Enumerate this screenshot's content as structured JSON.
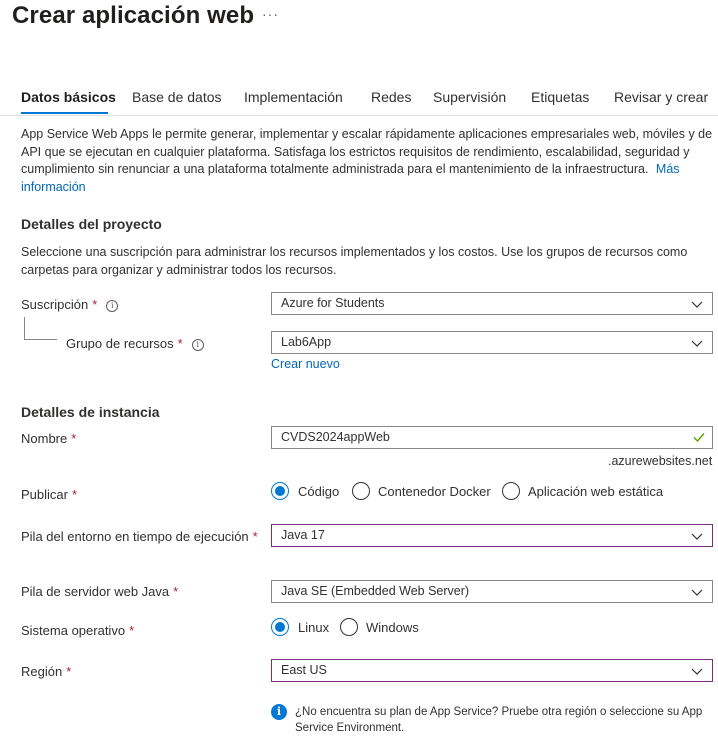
{
  "header": {
    "title": "Crear aplicación web",
    "more_label": "···"
  },
  "tabs": [
    {
      "label": "Datos básicos",
      "active": true
    },
    {
      "label": "Base de datos",
      "active": false
    },
    {
      "label": "Implementación",
      "active": false
    },
    {
      "label": "Redes",
      "active": false
    },
    {
      "label": "Supervisión",
      "active": false
    },
    {
      "label": "Etiquetas",
      "active": false
    },
    {
      "label": "Revisar y crear",
      "active": false
    }
  ],
  "intro": {
    "text": "App Service Web Apps le permite generar, implementar y escalar rápidamente aplicaciones empresariales web, móviles y de API que se ejecutan en cualquier plataforma. Satisfaga los estrictos requisitos de rendimiento, escalabilidad, seguridad y cumplimiento sin renunciar a una plataforma totalmente administrada para el mantenimiento de la infraestructura.",
    "link": "Más información"
  },
  "project": {
    "heading": "Detalles del proyecto",
    "description": "Seleccione una suscripción para administrar los recursos implementados y los costos. Use los grupos de recursos como carpetas para organizar y administrar todos los recursos.",
    "subscription_label": "Suscripción",
    "subscription_value": "Azure for Students",
    "resource_group_label": "Grupo de recursos",
    "resource_group_value": "Lab6App",
    "create_new_link": "Crear nuevo"
  },
  "instance": {
    "heading": "Detalles de instancia",
    "name_label": "Nombre",
    "name_value": "CVDS2024appWeb",
    "name_suffix": ".azurewebsites.net",
    "publish_label": "Publicar",
    "publish_options": [
      "Código",
      "Contenedor Docker",
      "Aplicación web estática"
    ],
    "publish_selected": "Código",
    "runtime_label": "Pila del entorno en tiempo de ejecución",
    "runtime_value": "Java 17",
    "java_stack_label": "Pila de servidor web Java",
    "java_stack_value": "Java SE (Embedded Web Server)",
    "os_label": "Sistema operativo",
    "os_options": [
      "Linux",
      "Windows"
    ],
    "os_selected": "Linux",
    "region_label": "Región",
    "region_value": "East US",
    "region_note": "¿No encuentra su plan de App Service? Pruebe otra región o seleccione su App Service Environment."
  },
  "required_marker": "*",
  "colors": {
    "accent": "#0078d4",
    "link": "#0067b8",
    "required": "#a4262c",
    "focus_border": "#7a2c80",
    "valid_check": "#57a300"
  }
}
